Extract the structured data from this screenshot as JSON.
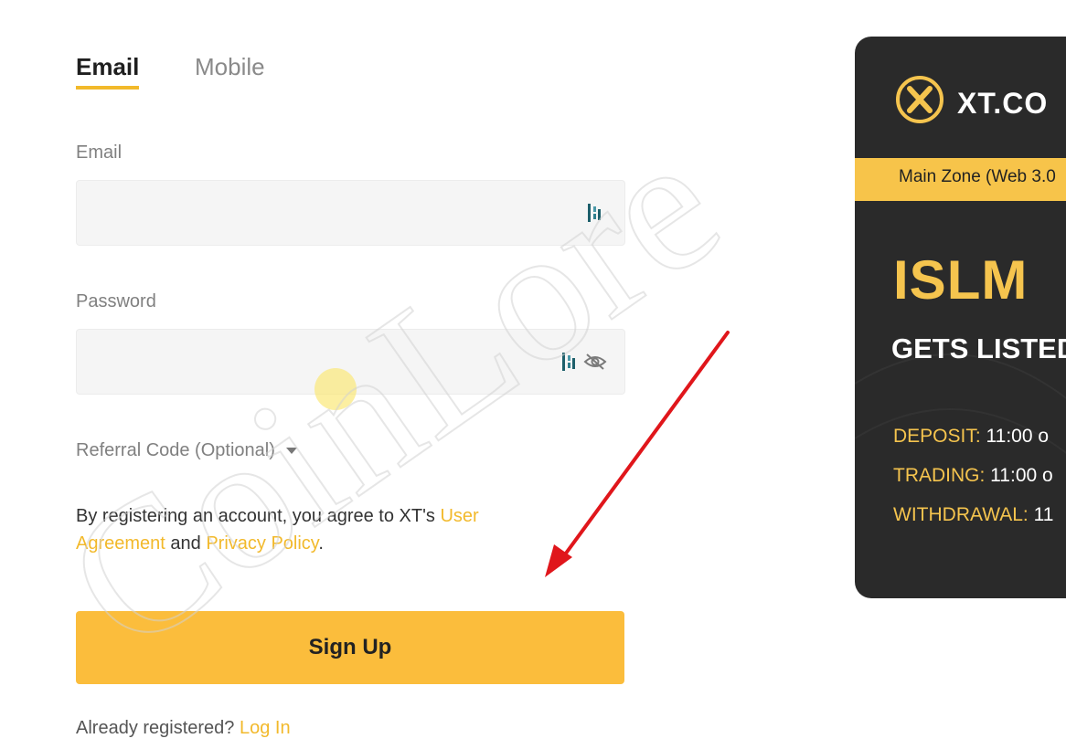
{
  "tabs": [
    {
      "label": "Email",
      "active": true
    },
    {
      "label": "Mobile",
      "active": false
    }
  ],
  "form": {
    "email_label": "Email",
    "email_value": "",
    "password_label": "Password",
    "password_value": "",
    "referral_label": "Referral Code (Optional)"
  },
  "agreement": {
    "prefix": "By registering an account, you agree to XT's ",
    "user_agreement": "User Agreement",
    "and": " and ",
    "privacy_policy": "Privacy Policy",
    "suffix": "."
  },
  "signup_label": "Sign Up",
  "footer": {
    "already": "Already registered? ",
    "login": "Log In"
  },
  "banner": {
    "logo_text": "XT.CO",
    "zone": "Main Zone (Web 3.0",
    "headline": "ISLM",
    "subheadline": "GETS LISTED",
    "schedule": [
      {
        "key": "DEPOSIT:",
        "value": " 11:00 o"
      },
      {
        "key": "TRADING:",
        "value": " 11:00 o"
      },
      {
        "key": "WITHDRAWAL:",
        "value": " 11"
      }
    ]
  },
  "watermark_text": "CoinLore",
  "colors": {
    "accent": "#f2b92b",
    "button": "#fbbd3c",
    "banner_bg": "#2a2a2a",
    "arrow": "#e0161b"
  },
  "icons": {
    "password_manager": "password-manager-icon",
    "visibility": "eye-off-icon",
    "dropdown": "caret-down-icon",
    "logo": "xt-logo-icon"
  }
}
